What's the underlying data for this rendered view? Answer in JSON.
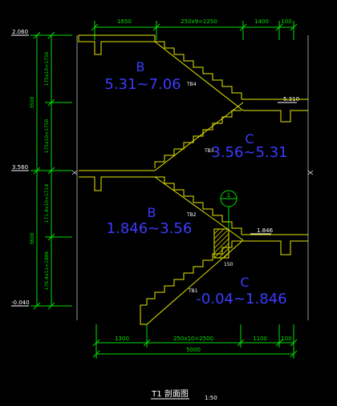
{
  "drawing": {
    "title": "T1 剖面图",
    "scale": "1:50"
  },
  "levels": {
    "top": "2.060",
    "mid": "3.560",
    "bottom": "-0.040",
    "right_upper": "5.310",
    "right_lower": "1.846"
  },
  "dims_top": {
    "d1": "1650",
    "d2": "250x9=2250",
    "d3": "1400",
    "d4": "100"
  },
  "dims_bottom": {
    "d1": "1300",
    "d2": "250x10=2500",
    "d3": "1100",
    "d4": "100",
    "total": "5000"
  },
  "dims_left": {
    "upper_total": "3500",
    "upper_a": "175x10=1750",
    "upper_b": "175x10=1750",
    "lower_total": "3600",
    "lower_a": "171.4x10=1714",
    "lower_b": "176.4x11=1886"
  },
  "flights": [
    {
      "letter": "B",
      "range": "5.31~7.06",
      "tag": "TB4"
    },
    {
      "letter": "C",
      "range": "3.56~5.31",
      "tag": "TB3"
    },
    {
      "letter": "B",
      "range": "1.846~3.56",
      "tag": "TB2"
    },
    {
      "letter": "C",
      "range": "-0.04~1.846",
      "tag": "TB1"
    }
  ],
  "small_labels": {
    "beam": "150",
    "grid_marker": "1"
  },
  "colors": {
    "background": "#000000",
    "concrete": "#e8e800",
    "dimension": "#00e000",
    "annotation": "#3b3bff",
    "text": "#ffffff",
    "hatch": "#e0e000"
  }
}
